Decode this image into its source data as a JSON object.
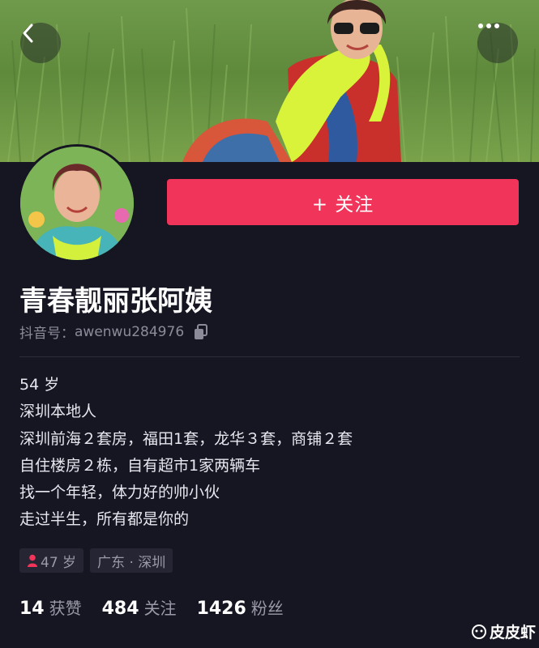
{
  "profile": {
    "follow_label": "+ 关注",
    "nickname": "青春靓丽张阿姨",
    "id_prefix": "抖音号：",
    "id_value": "awenwu284976",
    "bio": [
      "54 岁",
      "深圳本地人",
      "深圳前海２套房，福田1套，龙华３套，商铺２套",
      "自住楼房２栋，自有超市1家两辆车",
      "找一个年轻，体力好的帅小伙",
      "走过半生，所有都是你的"
    ],
    "tags": {
      "age": "47 岁",
      "location": "广东 · 深圳"
    },
    "stats": {
      "likes_count": "14",
      "likes_label": "获赞",
      "following_count": "484",
      "following_label": "关注",
      "followers_count": "1426",
      "followers_label": "粉丝"
    }
  },
  "icons": {
    "back": "chevron-left-icon",
    "more": "more-dots-icon",
    "copy": "copy-icon",
    "age": "female-person-icon"
  },
  "colors": {
    "accent": "#f1345a",
    "background": "#161623",
    "muted_text": "#8b8b9a"
  },
  "watermark": {
    "text": "皮皮虾"
  }
}
